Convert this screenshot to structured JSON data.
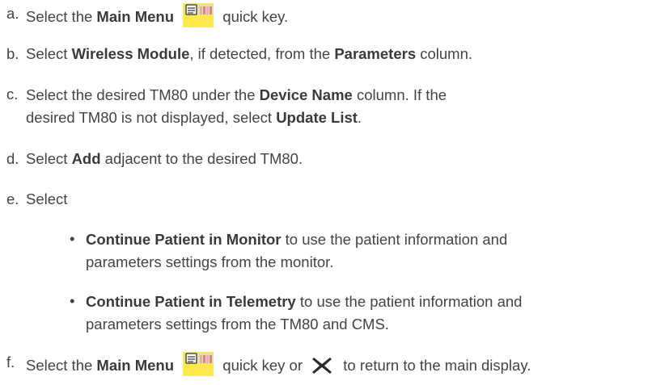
{
  "colors": {
    "text": "#444444",
    "icon_yellow": "#ffe94a",
    "icon_pink": "#f0a6c8",
    "icon_dark": "#3a3a3a"
  },
  "icons": {
    "main_menu": "main-menu-icon",
    "close": "close-x-icon"
  },
  "steps": {
    "a": {
      "label": "a.",
      "pre": "Select the ",
      "bold1": "Main Menu",
      "post": " quick key."
    },
    "b": {
      "label": "b.",
      "pre": "Select ",
      "bold1": "Wireless Module",
      "mid": ", if detected, from the ",
      "bold2": "Parameters",
      "post": " column."
    },
    "c": {
      "label": "c.",
      "pre": "Select the desired TM80 under the ",
      "bold1": "Device Name",
      "mid": " column. If the desired TM80 is not displayed, select ",
      "bold2": "Update List",
      "post": "."
    },
    "d": {
      "label": "d.",
      "pre": "Select ",
      "bold1": "Add",
      "post": " adjacent to the desired TM80."
    },
    "e": {
      "label": "e.",
      "text": "Select",
      "bullets": [
        {
          "bullet": "•",
          "bold": "Continue Patient in Monitor",
          "text": " to use the patient information and parameters settings from the monitor."
        },
        {
          "bullet": "•",
          "bold": "Continue Patient in Telemetry",
          "text": " to use the patient information and parameters settings from the TM80 and CMS."
        }
      ]
    },
    "f": {
      "label": "f.",
      "pre": "Select the ",
      "bold1": "Main Menu",
      "mid": " quick key or ",
      "post": " to return to the main display."
    }
  }
}
